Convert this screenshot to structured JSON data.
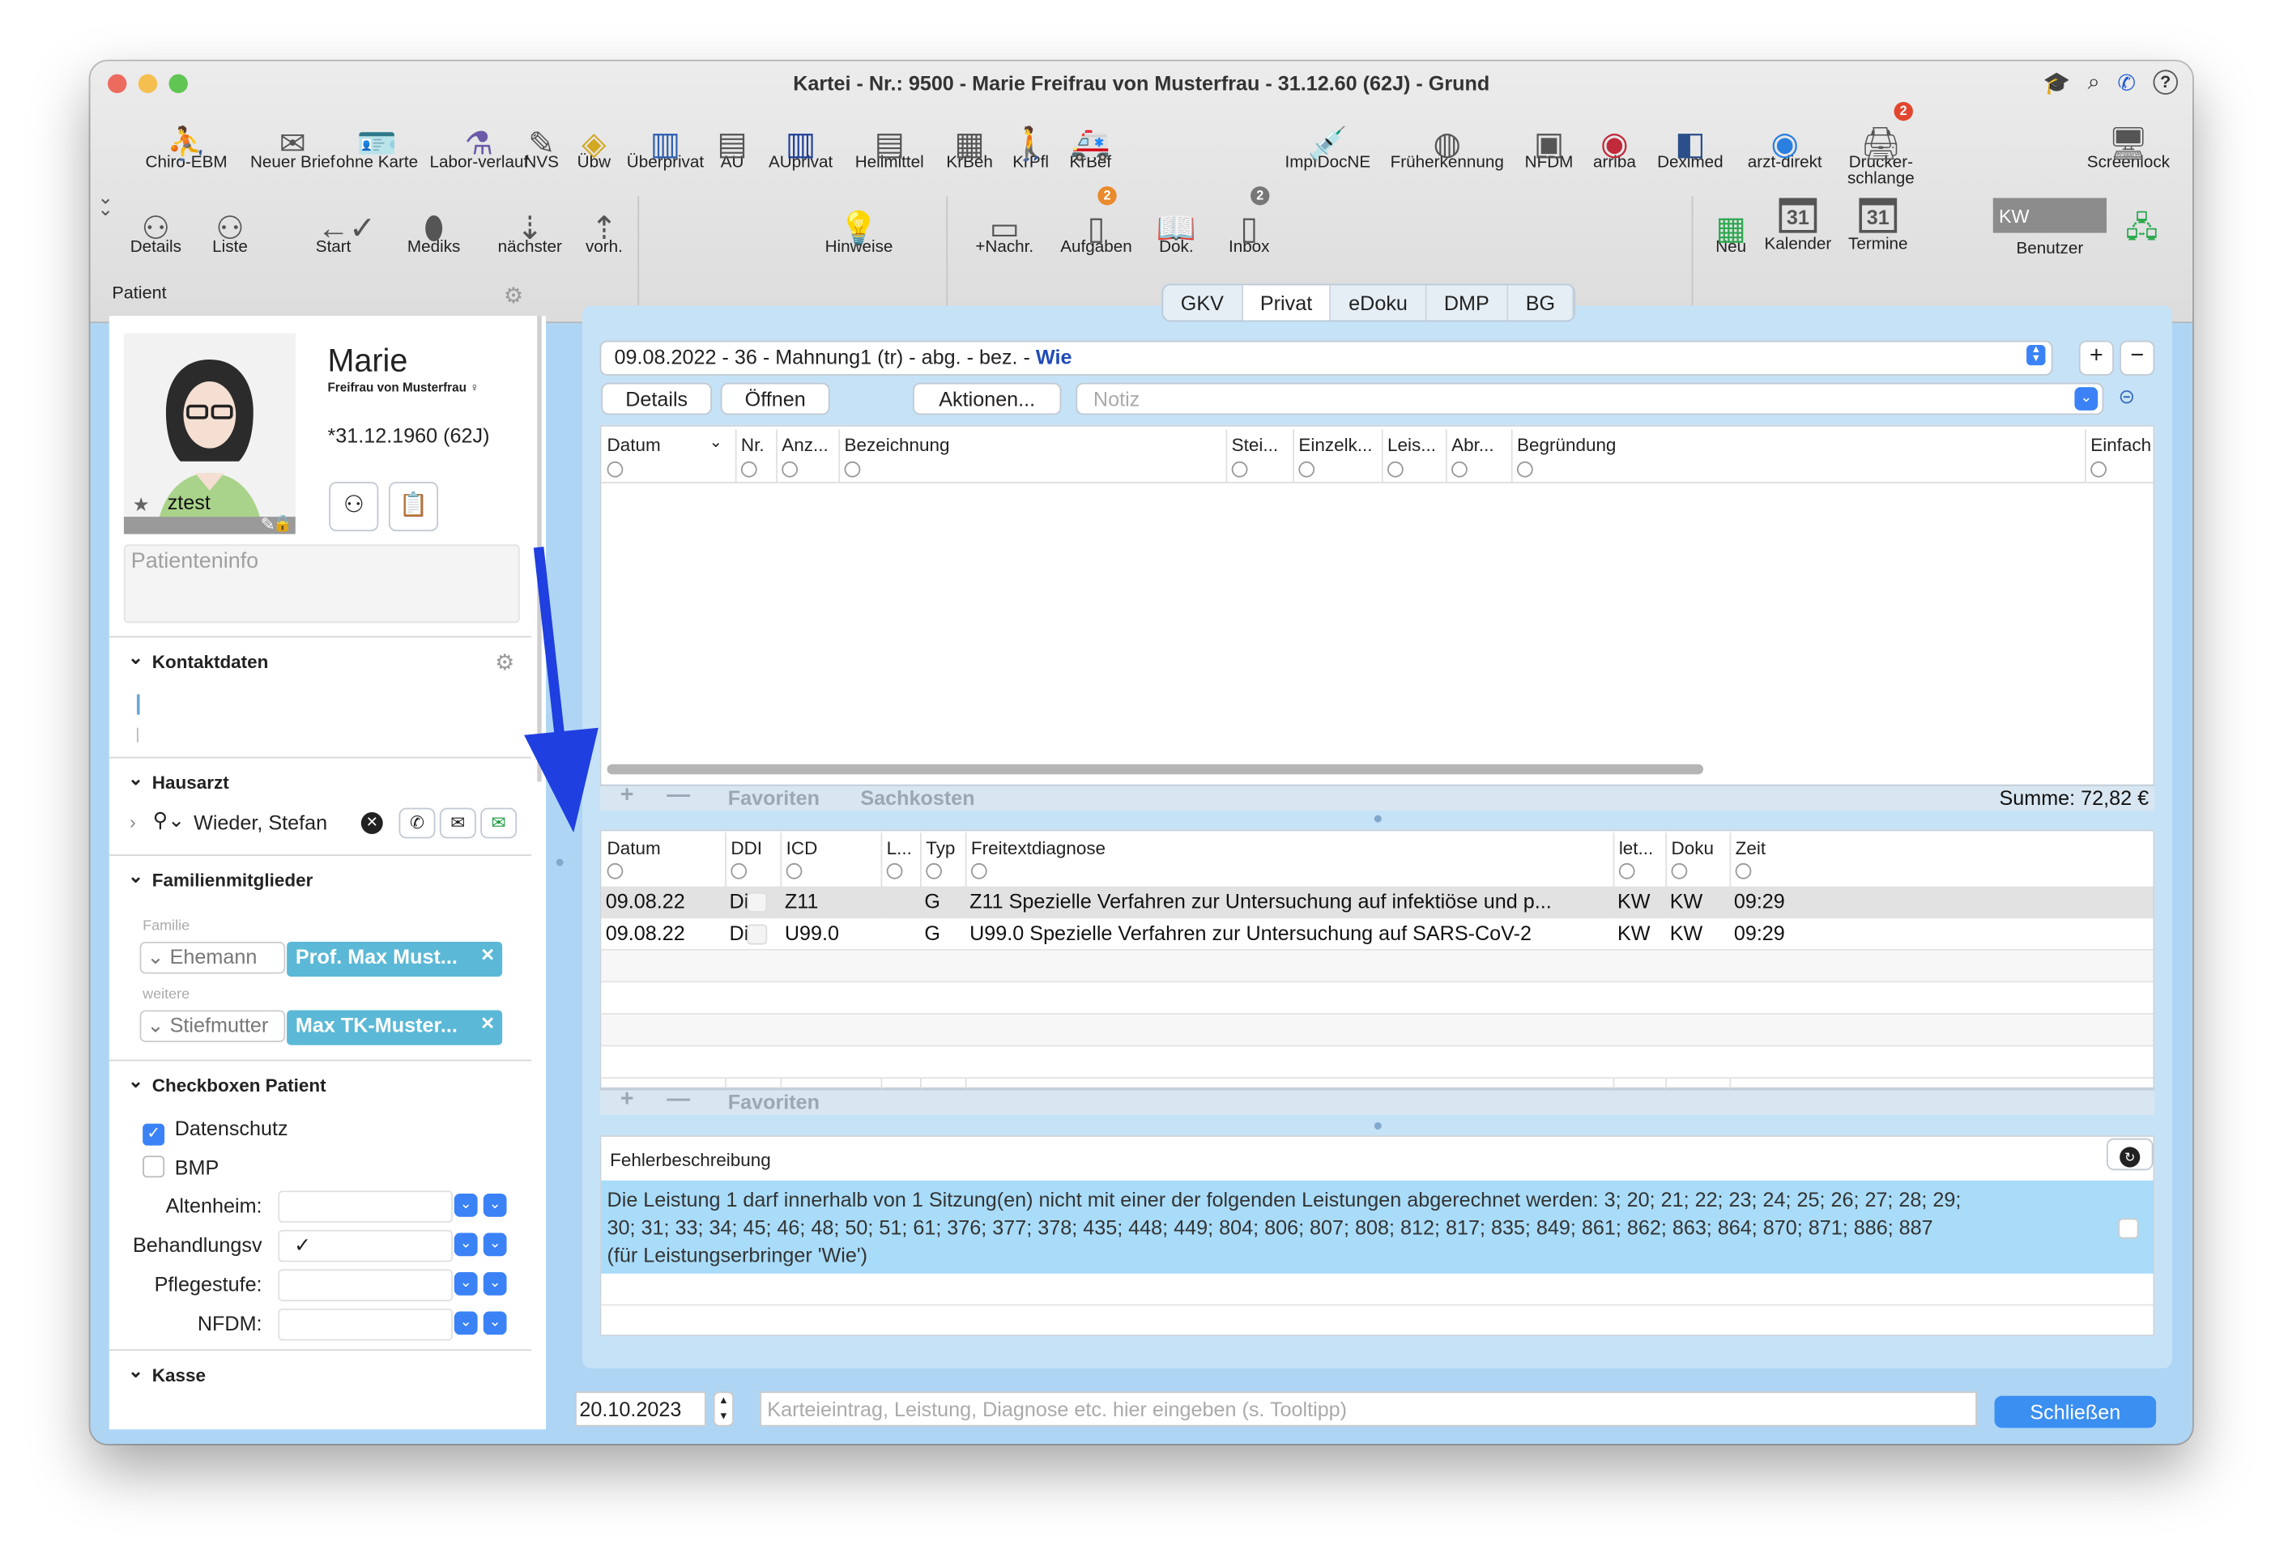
{
  "window": {
    "title": "Kartei - Nr.: 9500 - Marie Freifrau von Musterfrau - 31.12.60 (62J) - Grund"
  },
  "toolbar1": [
    {
      "label": "Chiro-EBM",
      "icon": "chiro-icon"
    },
    {
      "label": "Neuer Brief",
      "icon": "letter-icon"
    },
    {
      "label": "ohne Karte",
      "icon": "no-card-icon"
    },
    {
      "label": "Labor-verlauf",
      "icon": "lab-flask-icon"
    },
    {
      "label": "NVS",
      "icon": "nvs-icon"
    },
    {
      "label": "Übw",
      "icon": "referral-icon"
    },
    {
      "label": "Überprivat",
      "icon": "document-blue-icon"
    },
    {
      "label": "AU",
      "icon": "au-document-icon"
    },
    {
      "label": "AUprivat",
      "icon": "au-private-icon"
    },
    {
      "label": "Heilmittel",
      "icon": "remedy-icon"
    },
    {
      "label": "KrBeh",
      "icon": "hospital-icon"
    },
    {
      "label": "KrPfl",
      "icon": "walking-person-icon"
    },
    {
      "label": "KrBef",
      "icon": "ambulance-icon"
    },
    {
      "label": "ImpfDocNE",
      "icon": "syringe-icon"
    },
    {
      "label": "Früherkennung",
      "icon": "globe-icon"
    },
    {
      "label": "NFDM",
      "icon": "nfdm-icon"
    },
    {
      "label": "arriba",
      "icon": "arriba-icon"
    },
    {
      "label": "Deximed",
      "icon": "deximed-icon"
    },
    {
      "label": "arzt-direkt",
      "icon": "arzt-direkt-icon"
    },
    {
      "label": "Drucker-schlange",
      "icon": "printer-queue-icon",
      "badge": "2"
    },
    {
      "label": "Screenlock",
      "icon": "screen-lock-icon"
    }
  ],
  "toolbar2": [
    {
      "label": "Details",
      "icon": "person-icon"
    },
    {
      "label": "Liste",
      "icon": "add-person-icon"
    },
    {
      "label": "Start",
      "icon": "back-arrow-icon"
    },
    {
      "label": "",
      "icon": "checkmark-circle-icon"
    },
    {
      "label": "Mediks",
      "icon": "pill-icon"
    },
    {
      "label": "nächster",
      "icon": "next-down-icon"
    },
    {
      "label": "vorh.",
      "icon": "previous-up-icon"
    },
    {
      "label": "Hinweise",
      "icon": "hints-icon"
    },
    {
      "label": "+Nachr.",
      "icon": "message-icon"
    },
    {
      "label": "Aufgaben",
      "icon": "tasks-icon",
      "badge": "2"
    },
    {
      "label": "Dok.",
      "icon": "book-icon"
    },
    {
      "label": "Inbox",
      "icon": "inbox-icon",
      "badge": "2"
    },
    {
      "label": "Neu",
      "icon": "new-calendar-icon"
    },
    {
      "label": "Kalender",
      "icon": "calendar-icon",
      "day": "31"
    },
    {
      "label": "Termine",
      "icon": "appointments-icon",
      "day": "31"
    },
    {
      "label": "Benutzer",
      "icon": "user-box-icon",
      "value": "KW"
    }
  ],
  "sidebar": {
    "header": "Patient",
    "patient": {
      "first_name": "Marie",
      "title_line": "Freifrau von Musterfrau ♀",
      "birth": "*31.12.1960 (62J)",
      "tag": "ztest",
      "info_placeholder": "Patienteninfo"
    },
    "kontaktdaten": {
      "label": "Kontaktdaten"
    },
    "hausarzt": {
      "label": "Hausarzt",
      "name": "Wieder, Stefan"
    },
    "familie": {
      "label": "Familienmitglieder",
      "group1": "Familie",
      "rel1": "Ehemann",
      "member1": "Prof. Max Must...",
      "group2": "weitere",
      "rel2": "Stiefmutter",
      "member2": "Max TK-Muster..."
    },
    "checkboxen": {
      "label": "Checkboxen Patient",
      "datenschutz": "Datenschutz",
      "datenschutz_checked": true,
      "bmp": "BMP",
      "bmp_checked": false,
      "fields": [
        {
          "label": "Altenheim:",
          "value": ""
        },
        {
          "label": "Behandlungsv",
          "value": "✓"
        },
        {
          "label": "Pflegestufe:",
          "value": ""
        },
        {
          "label": "NFDM:",
          "value": ""
        }
      ]
    },
    "kasse": {
      "label": "Kasse"
    }
  },
  "tabs": [
    {
      "label": "GKV",
      "active": false
    },
    {
      "label": "Privat",
      "active": true
    },
    {
      "label": "eDoku",
      "active": false
    },
    {
      "label": "DMP",
      "active": false
    },
    {
      "label": "BG",
      "active": false
    }
  ],
  "invoice": {
    "prefix": "09.08.2022 - 36 - Mahnung1 (tr) - abg. - bez. - ",
    "highlight": "Wie"
  },
  "buttons": {
    "details": "Details",
    "open": "Öffnen",
    "actions": "Aktionen...",
    "note_placeholder": "Notiz"
  },
  "services_table": {
    "columns": [
      "Datum",
      "Nr.",
      "Anz...",
      "Bezeichnung",
      "Stei...",
      "Einzelk...",
      "Leis...",
      "Abr...",
      "Begründung",
      "Einfach"
    ],
    "rows": [],
    "footer": {
      "favorites": "Favoriten",
      "material": "Sachkosten",
      "sum": "Summe: 72,82 €"
    }
  },
  "diag_table": {
    "columns": [
      "Datum",
      "DDI",
      "ICD",
      "L...",
      "Typ",
      "Freitextdiagnose",
      "let...",
      "Doku",
      "Zeit"
    ],
    "rows": [
      {
        "datum": "09.08.22",
        "ddi": "Di",
        "icd": "Z11",
        "l": "",
        "typ": "G",
        "text": "Z11 Spezielle Verfahren zur Untersuchung auf infektiöse und p...",
        "let": "KW",
        "doku": "KW",
        "zeit": "09:29"
      },
      {
        "datum": "09.08.22",
        "ddi": "Di",
        "icd": "U99.0",
        "l": "",
        "typ": "G",
        "text": "U99.0 Spezielle Verfahren zur Untersuchung auf SARS-CoV-2",
        "let": "KW",
        "doku": "KW",
        "zeit": "09:29"
      }
    ],
    "footer": {
      "favorites": "Favoriten"
    }
  },
  "errors": {
    "header": "Fehlerbeschreibung",
    "line1": "Die Leistung 1 darf innerhalb von 1 Sitzung(en) nicht mit einer der folgenden Leistungen abgerechnet werden: 3; 20; 21; 22; 23; 24; 25; 26; 27; 28; 29;",
    "line2": "30; 31; 33; 34; 45; 46; 48; 50; 51; 61; 376; 377; 378; 435; 448; 449; 804; 806; 807; 808; 812; 817; 835; 849; 861; 862; 863; 864; 870; 871; 886; 887",
    "line3": "(für Leistungserbringer 'Wie')"
  },
  "bottom": {
    "date": "20.10.2023",
    "entry_placeholder": "Karteieintrag, Leistung, Diagnose etc. hier eingeben (s. Tooltipp)",
    "close": "Schließen"
  },
  "colors": {
    "accent": "#3b8ff0",
    "panel": "#aed6f4",
    "tag": "#5bb8d6",
    "arrow": "#1f3fe0",
    "badge": "#e3462f"
  }
}
